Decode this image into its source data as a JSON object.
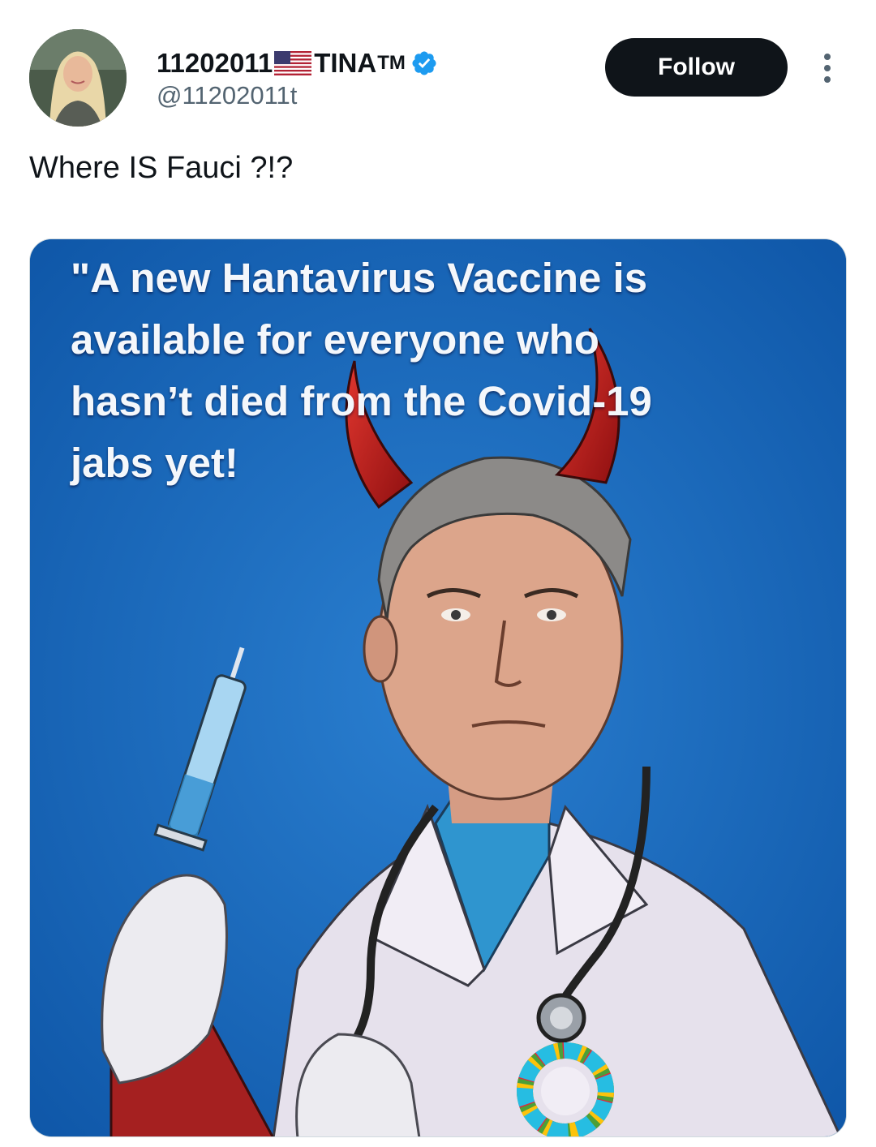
{
  "post": {
    "display_name": "11202011",
    "display_name_suffix": "TINA",
    "trademark": "TM",
    "handle": "@11202011t",
    "follow_label": "Follow",
    "text": "Where IS Fauci ?!?"
  },
  "media": {
    "caption_lines": [
      "\"A new Hantavirus Vaccine is",
      "available for everyone who",
      "hasn’t died from the Covid-19",
      "jabs yet!"
    ]
  },
  "icons": {
    "flag": "us-flag-icon",
    "verified": "verified-badge-icon",
    "more": "more-options-icon"
  },
  "colors": {
    "follow_button": "#0f1419",
    "verified_badge": "#1d9bf0",
    "poster_background": "#1565b8",
    "handle_text": "#536471"
  }
}
